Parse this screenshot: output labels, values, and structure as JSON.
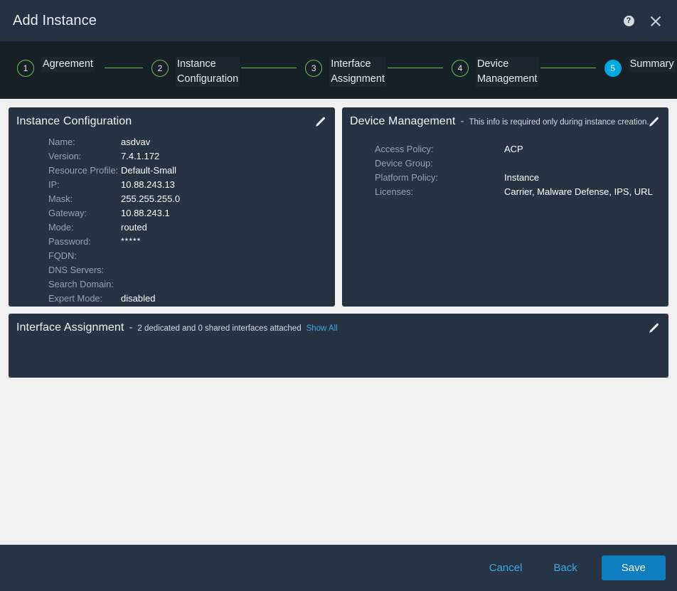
{
  "header": {
    "title": "Add Instance",
    "help_icon": "help-circle-icon",
    "help_glyph": "?",
    "close_icon": "close-icon"
  },
  "stepper": {
    "steps": [
      {
        "number": "1",
        "label": "Agreement",
        "state": "done"
      },
      {
        "number": "2",
        "label": "Instance\nConfiguration",
        "state": "done"
      },
      {
        "number": "3",
        "label": "Interface\nAssignment",
        "state": "done"
      },
      {
        "number": "4",
        "label": "Device\nManagement",
        "state": "done"
      },
      {
        "number": "5",
        "label": "Summary",
        "state": "active"
      }
    ],
    "done_color": "#6cbf4b",
    "active_color": "#00a9e0"
  },
  "cards": {
    "instance_configuration": {
      "title": "Instance Configuration",
      "edit_icon": "pencil-icon",
      "rows": [
        {
          "label": "Name:",
          "value": "asdvav"
        },
        {
          "label": "Version:",
          "value": "7.4.1.172"
        },
        {
          "label": "Resource Profile:",
          "value": "Default-Small"
        },
        {
          "label": "IP:",
          "value": "10.88.243.13"
        },
        {
          "label": "Mask:",
          "value": "255.255.255.0"
        },
        {
          "label": "Gateway:",
          "value": "10.88.243.1"
        },
        {
          "label": "Mode:",
          "value": "routed"
        },
        {
          "label": "Password:",
          "value": "*****"
        },
        {
          "label": "FQDN:",
          "value": ""
        },
        {
          "label": "DNS Servers:",
          "value": ""
        },
        {
          "label": "Search Domain:",
          "value": ""
        },
        {
          "label": "Expert Mode:",
          "value": "disabled"
        }
      ]
    },
    "device_management": {
      "title": "Device Management",
      "dash": "-",
      "subtitle": "This info is required only during instance creation.",
      "edit_icon": "pencil-icon",
      "rows": [
        {
          "label": "Access Policy:",
          "value": "ACP"
        },
        {
          "label": "Device Group:",
          "value": ""
        },
        {
          "label": "Platform Policy:",
          "value": "Instance"
        },
        {
          "label": "Licenses:",
          "value": "Carrier, Malware Defense, IPS, URL"
        }
      ]
    },
    "interface_assignment": {
      "title": "Interface Assignment",
      "dash": "-",
      "subtitle": "2 dedicated and 0 shared interfaces attached",
      "show_all": "Show All",
      "edit_icon": "pencil-icon"
    }
  },
  "footer": {
    "cancel_label": "Cancel",
    "back_label": "Back",
    "save_label": "Save",
    "primary_color": "#0f7ebf",
    "link_color": "#3ba7e8"
  }
}
